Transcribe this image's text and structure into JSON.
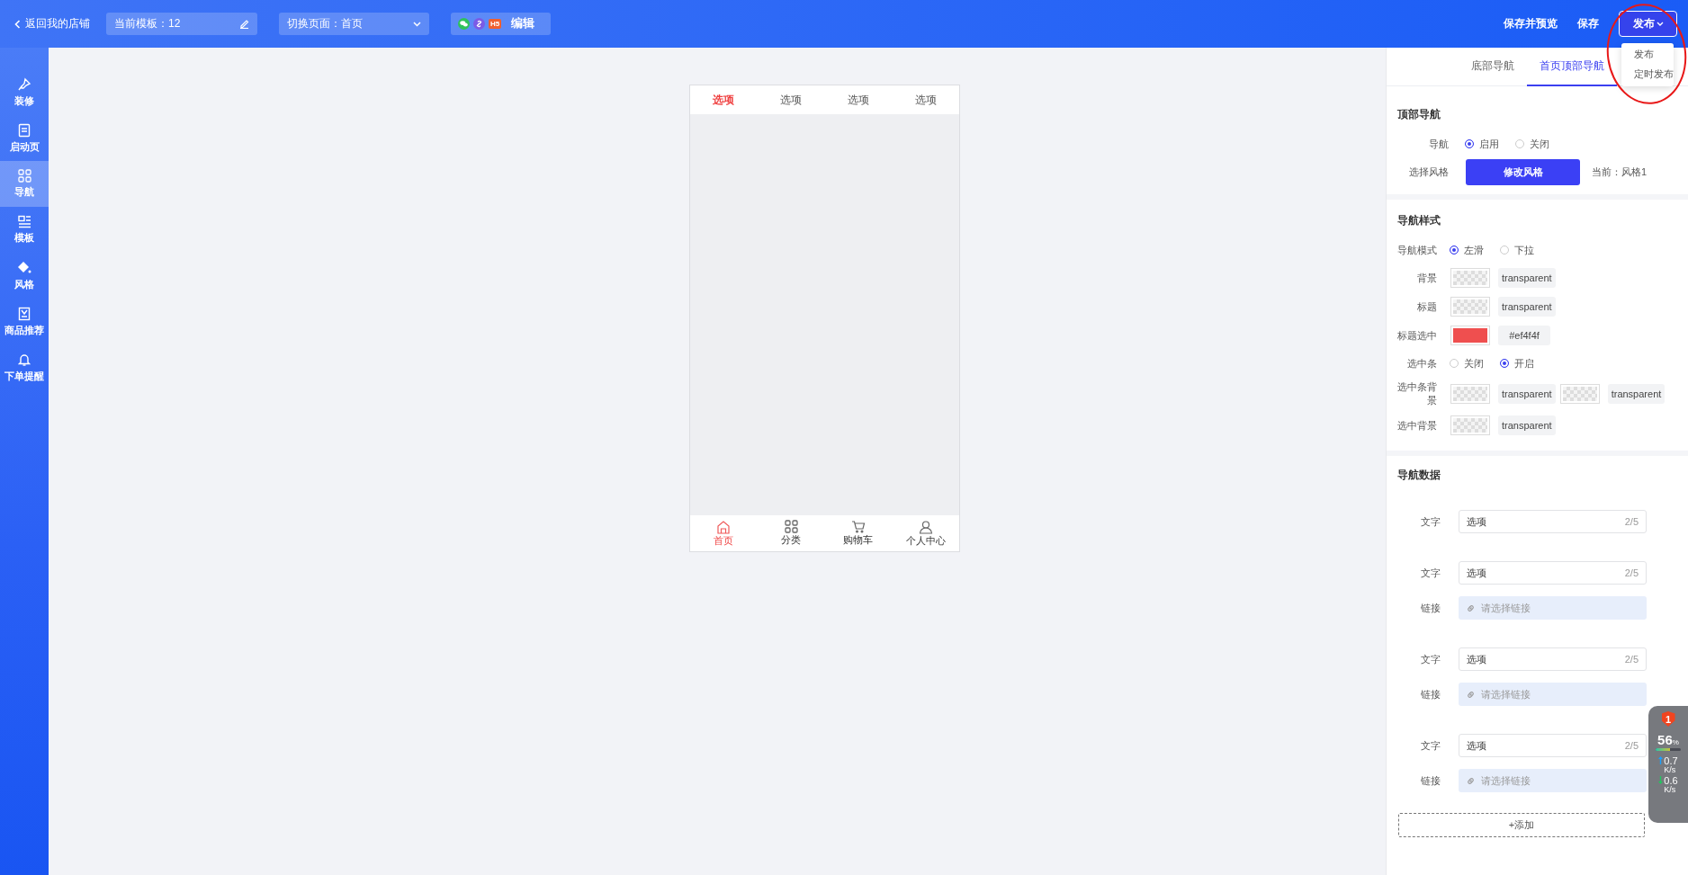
{
  "topbar": {
    "back_link": "返回我的店铺",
    "template_field": "当前模板：12",
    "page_select": "切换页面：首页",
    "channel_bar": {
      "badge": "H5",
      "action": "编辑"
    },
    "actions": [
      "保存并预览",
      "保存"
    ],
    "publish_button": "发布",
    "publish_menu": {
      "expanded": true,
      "items": [
        "发布",
        "定时发布"
      ]
    }
  },
  "sidebar": {
    "items": [
      {
        "label": "装修",
        "kind": "brush",
        "selected": false
      },
      {
        "label": "启动页",
        "kind": "page",
        "selected": false
      },
      {
        "label": "导航",
        "kind": "grid",
        "selected": true
      },
      {
        "label": "模板",
        "kind": "layout",
        "selected": false
      },
      {
        "label": "风格",
        "kind": "bucket",
        "selected": false
      },
      {
        "label": "商品推荐",
        "kind": "box",
        "selected": false
      },
      {
        "label": "下单提醒",
        "kind": "bell",
        "selected": false
      }
    ]
  },
  "preview": {
    "tabs": [
      {
        "label": "选项",
        "selected": true
      },
      {
        "label": "选项",
        "selected": false
      },
      {
        "label": "选项",
        "selected": false
      },
      {
        "label": "选项",
        "selected": false
      }
    ],
    "bottom_nav": [
      {
        "label": "首页",
        "kind": "home",
        "selected": true
      },
      {
        "label": "分类",
        "kind": "grid",
        "selected": false
      },
      {
        "label": "购物车",
        "kind": "cart",
        "selected": false
      },
      {
        "label": "个人中心",
        "kind": "person",
        "selected": false
      }
    ]
  },
  "panel": {
    "tabs": [
      {
        "label": "底部导航",
        "selected": false
      },
      {
        "label": "首页顶部导航",
        "selected": true
      }
    ],
    "top_nav": {
      "title": "顶部导航",
      "nav_label": "导航",
      "nav_options": [
        {
          "label": "启用",
          "selected": true
        },
        {
          "label": "关闭",
          "selected": false
        }
      ],
      "style_label": "选择风格",
      "style_button": "修改风格",
      "current_style": "当前：风格1"
    },
    "nav_style": {
      "title": "导航样式",
      "rows": [
        {
          "kind": "radio",
          "label": "导航模式",
          "options": [
            {
              "label": "左滑",
              "selected": true
            },
            {
              "label": "下拉",
              "selected": false
            }
          ]
        },
        {
          "kind": "color",
          "label": "背景",
          "values": [
            "transparent"
          ]
        },
        {
          "kind": "color",
          "label": "标题",
          "values": [
            "transparent"
          ]
        },
        {
          "kind": "color",
          "label": "标题选中",
          "values": [
            "#ef4f4f"
          ]
        },
        {
          "kind": "radio",
          "label": "选中条",
          "options": [
            {
              "label": "关闭",
              "selected": false
            },
            {
              "label": "开启",
              "selected": true
            }
          ]
        },
        {
          "kind": "color",
          "label": "选中条背景",
          "values": [
            "transparent",
            "transparent"
          ]
        },
        {
          "kind": "color",
          "label": "选中背景",
          "values": [
            "transparent"
          ]
        }
      ]
    },
    "nav_data": {
      "title": "导航数据",
      "items": [
        {
          "fields": [
            {
              "kind": "text",
              "label": "文字",
              "value": "选项",
              "count": "2/5"
            }
          ]
        },
        {
          "fields": [
            {
              "kind": "text",
              "label": "文字",
              "value": "选项",
              "count": "2/5"
            },
            {
              "kind": "link",
              "label": "链接",
              "placeholder": "请选择链接"
            }
          ]
        },
        {
          "fields": [
            {
              "kind": "text",
              "label": "文字",
              "value": "选项",
              "count": "2/5"
            },
            {
              "kind": "link",
              "label": "链接",
              "placeholder": "请选择链接"
            }
          ]
        },
        {
          "fields": [
            {
              "kind": "text",
              "label": "文字",
              "value": "选项",
              "count": "2/5"
            },
            {
              "kind": "link",
              "label": "链接",
              "placeholder": "请选择链接"
            }
          ]
        }
      ],
      "add_button": "+添加"
    }
  },
  "monitor_widget": {
    "alert_count": "1",
    "cpu": "56",
    "cpu_unit": "%",
    "level": 0.56,
    "upload": "0.7",
    "upload_unit": "K/s",
    "download": "0.6",
    "download_unit": "K/s"
  },
  "annotation_circle": true
}
